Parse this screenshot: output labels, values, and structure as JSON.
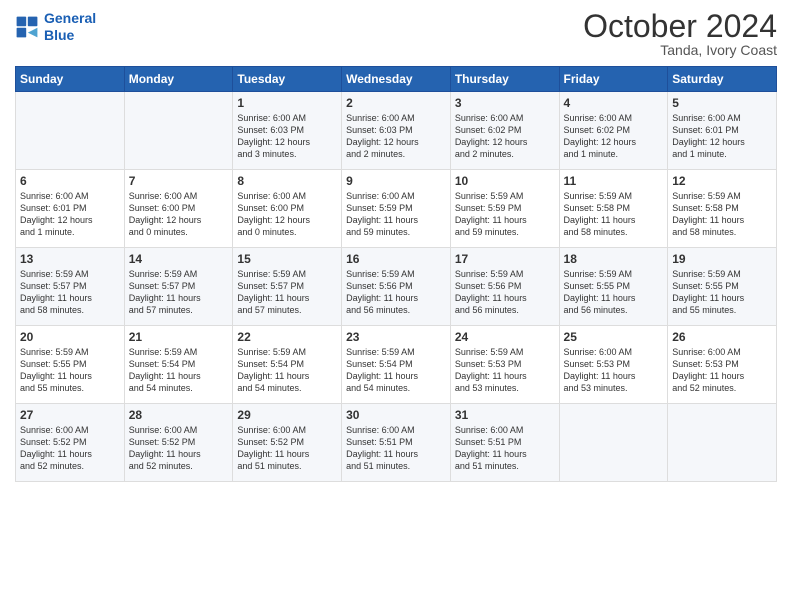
{
  "header": {
    "logo_line1": "General",
    "logo_line2": "Blue",
    "month": "October 2024",
    "location": "Tanda, Ivory Coast"
  },
  "weekdays": [
    "Sunday",
    "Monday",
    "Tuesday",
    "Wednesday",
    "Thursday",
    "Friday",
    "Saturday"
  ],
  "rows": [
    [
      {
        "day": "",
        "info": ""
      },
      {
        "day": "",
        "info": ""
      },
      {
        "day": "1",
        "info": "Sunrise: 6:00 AM\nSunset: 6:03 PM\nDaylight: 12 hours\nand 3 minutes."
      },
      {
        "day": "2",
        "info": "Sunrise: 6:00 AM\nSunset: 6:03 PM\nDaylight: 12 hours\nand 2 minutes."
      },
      {
        "day": "3",
        "info": "Sunrise: 6:00 AM\nSunset: 6:02 PM\nDaylight: 12 hours\nand 2 minutes."
      },
      {
        "day": "4",
        "info": "Sunrise: 6:00 AM\nSunset: 6:02 PM\nDaylight: 12 hours\nand 1 minute."
      },
      {
        "day": "5",
        "info": "Sunrise: 6:00 AM\nSunset: 6:01 PM\nDaylight: 12 hours\nand 1 minute."
      }
    ],
    [
      {
        "day": "6",
        "info": "Sunrise: 6:00 AM\nSunset: 6:01 PM\nDaylight: 12 hours\nand 1 minute."
      },
      {
        "day": "7",
        "info": "Sunrise: 6:00 AM\nSunset: 6:00 PM\nDaylight: 12 hours\nand 0 minutes."
      },
      {
        "day": "8",
        "info": "Sunrise: 6:00 AM\nSunset: 6:00 PM\nDaylight: 12 hours\nand 0 minutes."
      },
      {
        "day": "9",
        "info": "Sunrise: 6:00 AM\nSunset: 5:59 PM\nDaylight: 11 hours\nand 59 minutes."
      },
      {
        "day": "10",
        "info": "Sunrise: 5:59 AM\nSunset: 5:59 PM\nDaylight: 11 hours\nand 59 minutes."
      },
      {
        "day": "11",
        "info": "Sunrise: 5:59 AM\nSunset: 5:58 PM\nDaylight: 11 hours\nand 58 minutes."
      },
      {
        "day": "12",
        "info": "Sunrise: 5:59 AM\nSunset: 5:58 PM\nDaylight: 11 hours\nand 58 minutes."
      }
    ],
    [
      {
        "day": "13",
        "info": "Sunrise: 5:59 AM\nSunset: 5:57 PM\nDaylight: 11 hours\nand 58 minutes."
      },
      {
        "day": "14",
        "info": "Sunrise: 5:59 AM\nSunset: 5:57 PM\nDaylight: 11 hours\nand 57 minutes."
      },
      {
        "day": "15",
        "info": "Sunrise: 5:59 AM\nSunset: 5:57 PM\nDaylight: 11 hours\nand 57 minutes."
      },
      {
        "day": "16",
        "info": "Sunrise: 5:59 AM\nSunset: 5:56 PM\nDaylight: 11 hours\nand 56 minutes."
      },
      {
        "day": "17",
        "info": "Sunrise: 5:59 AM\nSunset: 5:56 PM\nDaylight: 11 hours\nand 56 minutes."
      },
      {
        "day": "18",
        "info": "Sunrise: 5:59 AM\nSunset: 5:55 PM\nDaylight: 11 hours\nand 56 minutes."
      },
      {
        "day": "19",
        "info": "Sunrise: 5:59 AM\nSunset: 5:55 PM\nDaylight: 11 hours\nand 55 minutes."
      }
    ],
    [
      {
        "day": "20",
        "info": "Sunrise: 5:59 AM\nSunset: 5:55 PM\nDaylight: 11 hours\nand 55 minutes."
      },
      {
        "day": "21",
        "info": "Sunrise: 5:59 AM\nSunset: 5:54 PM\nDaylight: 11 hours\nand 54 minutes."
      },
      {
        "day": "22",
        "info": "Sunrise: 5:59 AM\nSunset: 5:54 PM\nDaylight: 11 hours\nand 54 minutes."
      },
      {
        "day": "23",
        "info": "Sunrise: 5:59 AM\nSunset: 5:54 PM\nDaylight: 11 hours\nand 54 minutes."
      },
      {
        "day": "24",
        "info": "Sunrise: 5:59 AM\nSunset: 5:53 PM\nDaylight: 11 hours\nand 53 minutes."
      },
      {
        "day": "25",
        "info": "Sunrise: 6:00 AM\nSunset: 5:53 PM\nDaylight: 11 hours\nand 53 minutes."
      },
      {
        "day": "26",
        "info": "Sunrise: 6:00 AM\nSunset: 5:53 PM\nDaylight: 11 hours\nand 52 minutes."
      }
    ],
    [
      {
        "day": "27",
        "info": "Sunrise: 6:00 AM\nSunset: 5:52 PM\nDaylight: 11 hours\nand 52 minutes."
      },
      {
        "day": "28",
        "info": "Sunrise: 6:00 AM\nSunset: 5:52 PM\nDaylight: 11 hours\nand 52 minutes."
      },
      {
        "day": "29",
        "info": "Sunrise: 6:00 AM\nSunset: 5:52 PM\nDaylight: 11 hours\nand 51 minutes."
      },
      {
        "day": "30",
        "info": "Sunrise: 6:00 AM\nSunset: 5:51 PM\nDaylight: 11 hours\nand 51 minutes."
      },
      {
        "day": "31",
        "info": "Sunrise: 6:00 AM\nSunset: 5:51 PM\nDaylight: 11 hours\nand 51 minutes."
      },
      {
        "day": "",
        "info": ""
      },
      {
        "day": "",
        "info": ""
      }
    ]
  ]
}
